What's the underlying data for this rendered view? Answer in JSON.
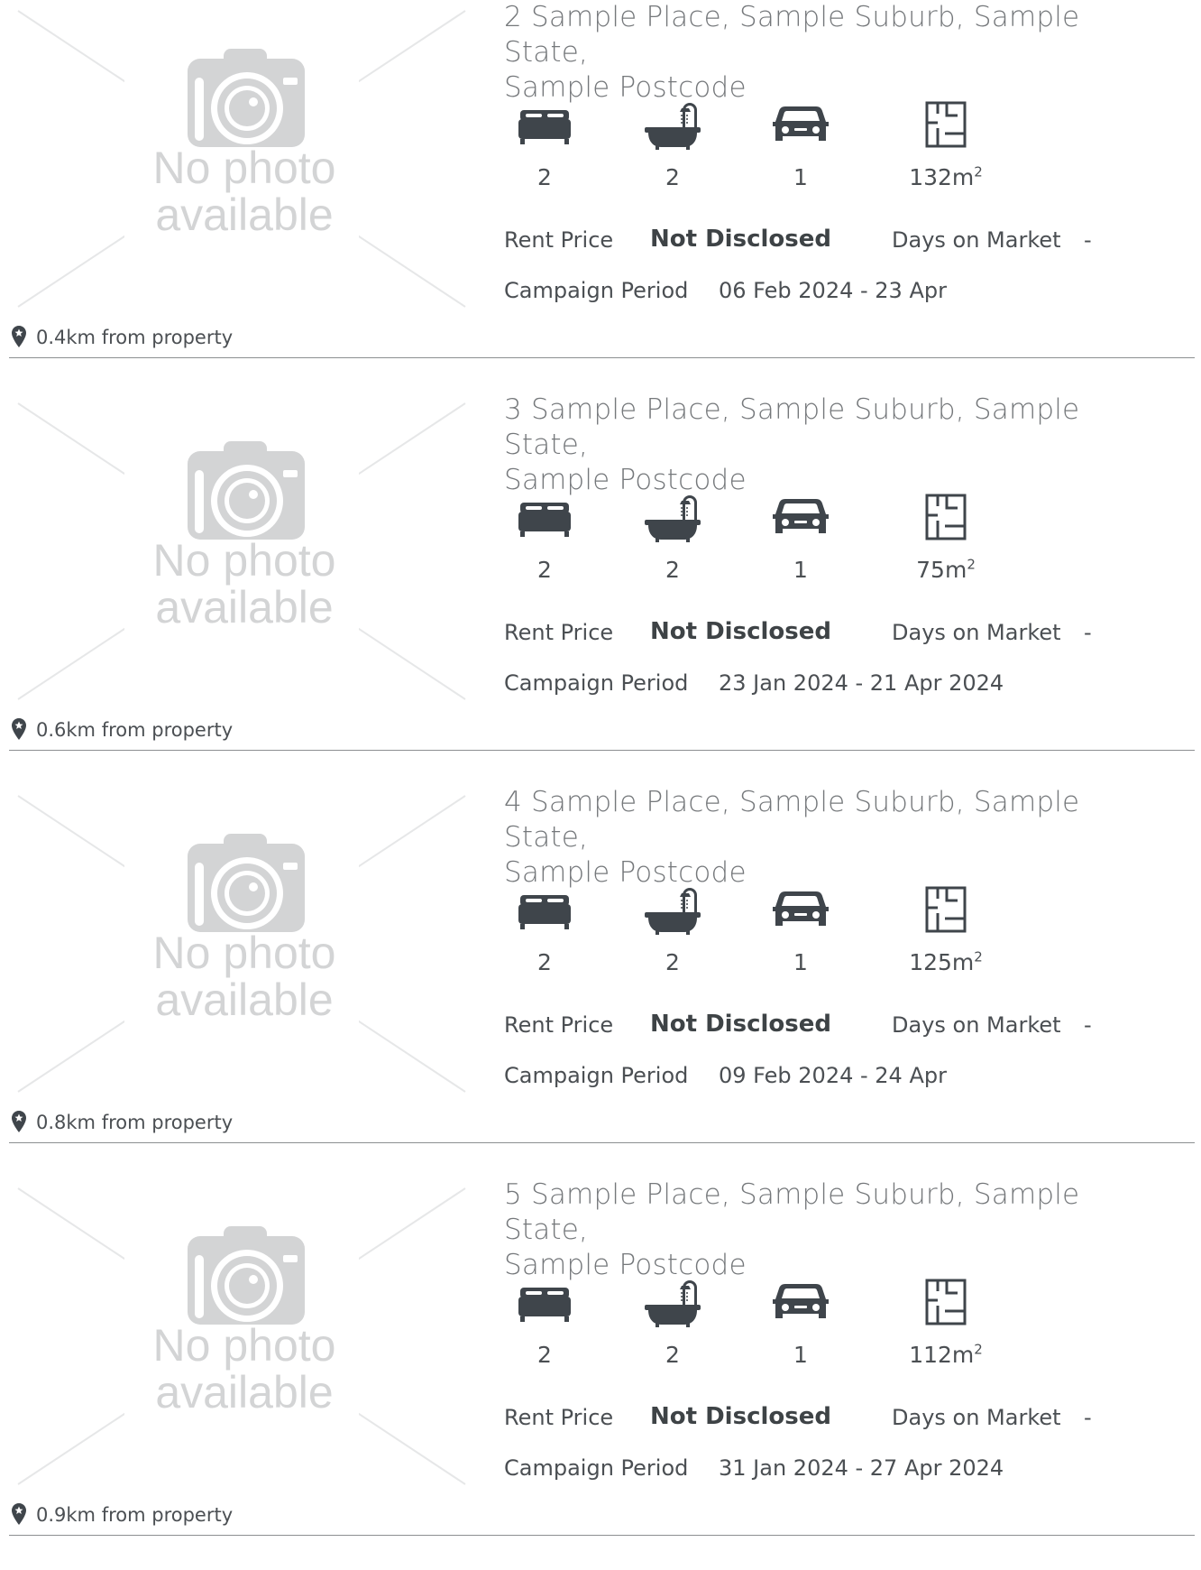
{
  "photo_placeholder": {
    "line1": "No photo",
    "line2": "available"
  },
  "labels": {
    "rent_price": "Rent Price",
    "days_on_market": "Days on Market",
    "campaign_period": "Campaign Period"
  },
  "icons": [
    "bed-icon",
    "bath-icon",
    "car-icon",
    "floorplan-icon",
    "location-pin-icon"
  ],
  "colors": {
    "icon": "#3f454b",
    "text": "#4b4f53",
    "address": "#75787b",
    "placeholder": "#cfd0d1",
    "divider": "#8c8f91"
  },
  "listings": [
    {
      "address_line1": "2 Sample Place, Sample Suburb, Sample State,",
      "address_line2": "Sample Postcode",
      "beds": "2",
      "baths": "2",
      "cars": "1",
      "area": "132m",
      "area_unit_sup": "2",
      "rent_price": "Not Disclosed",
      "days_on_market": "-",
      "campaign_period": "06 Feb 2024 - 23 Apr",
      "distance": "0.4km from property"
    },
    {
      "address_line1": "3 Sample Place, Sample Suburb, Sample State,",
      "address_line2": "Sample Postcode",
      "beds": "2",
      "baths": "2",
      "cars": "1",
      "area": "75m",
      "area_unit_sup": "2",
      "rent_price": "Not Disclosed",
      "days_on_market": "-",
      "campaign_period": "23 Jan 2024 - 21 Apr 2024",
      "distance": "0.6km from property"
    },
    {
      "address_line1": "4 Sample Place, Sample Suburb, Sample State,",
      "address_line2": "Sample Postcode",
      "beds": "2",
      "baths": "2",
      "cars": "1",
      "area": "125m",
      "area_unit_sup": "2",
      "rent_price": "Not Disclosed",
      "days_on_market": "-",
      "campaign_period": "09 Feb 2024 - 24 Apr",
      "distance": "0.8km from property"
    },
    {
      "address_line1": "5 Sample Place, Sample Suburb, Sample State,",
      "address_line2": "Sample Postcode",
      "beds": "2",
      "baths": "2",
      "cars": "1",
      "area": "112m",
      "area_unit_sup": "2",
      "rent_price": "Not Disclosed",
      "days_on_market": "-",
      "campaign_period": "31 Jan 2024 - 27 Apr 2024",
      "distance": "0.9km from property"
    }
  ]
}
